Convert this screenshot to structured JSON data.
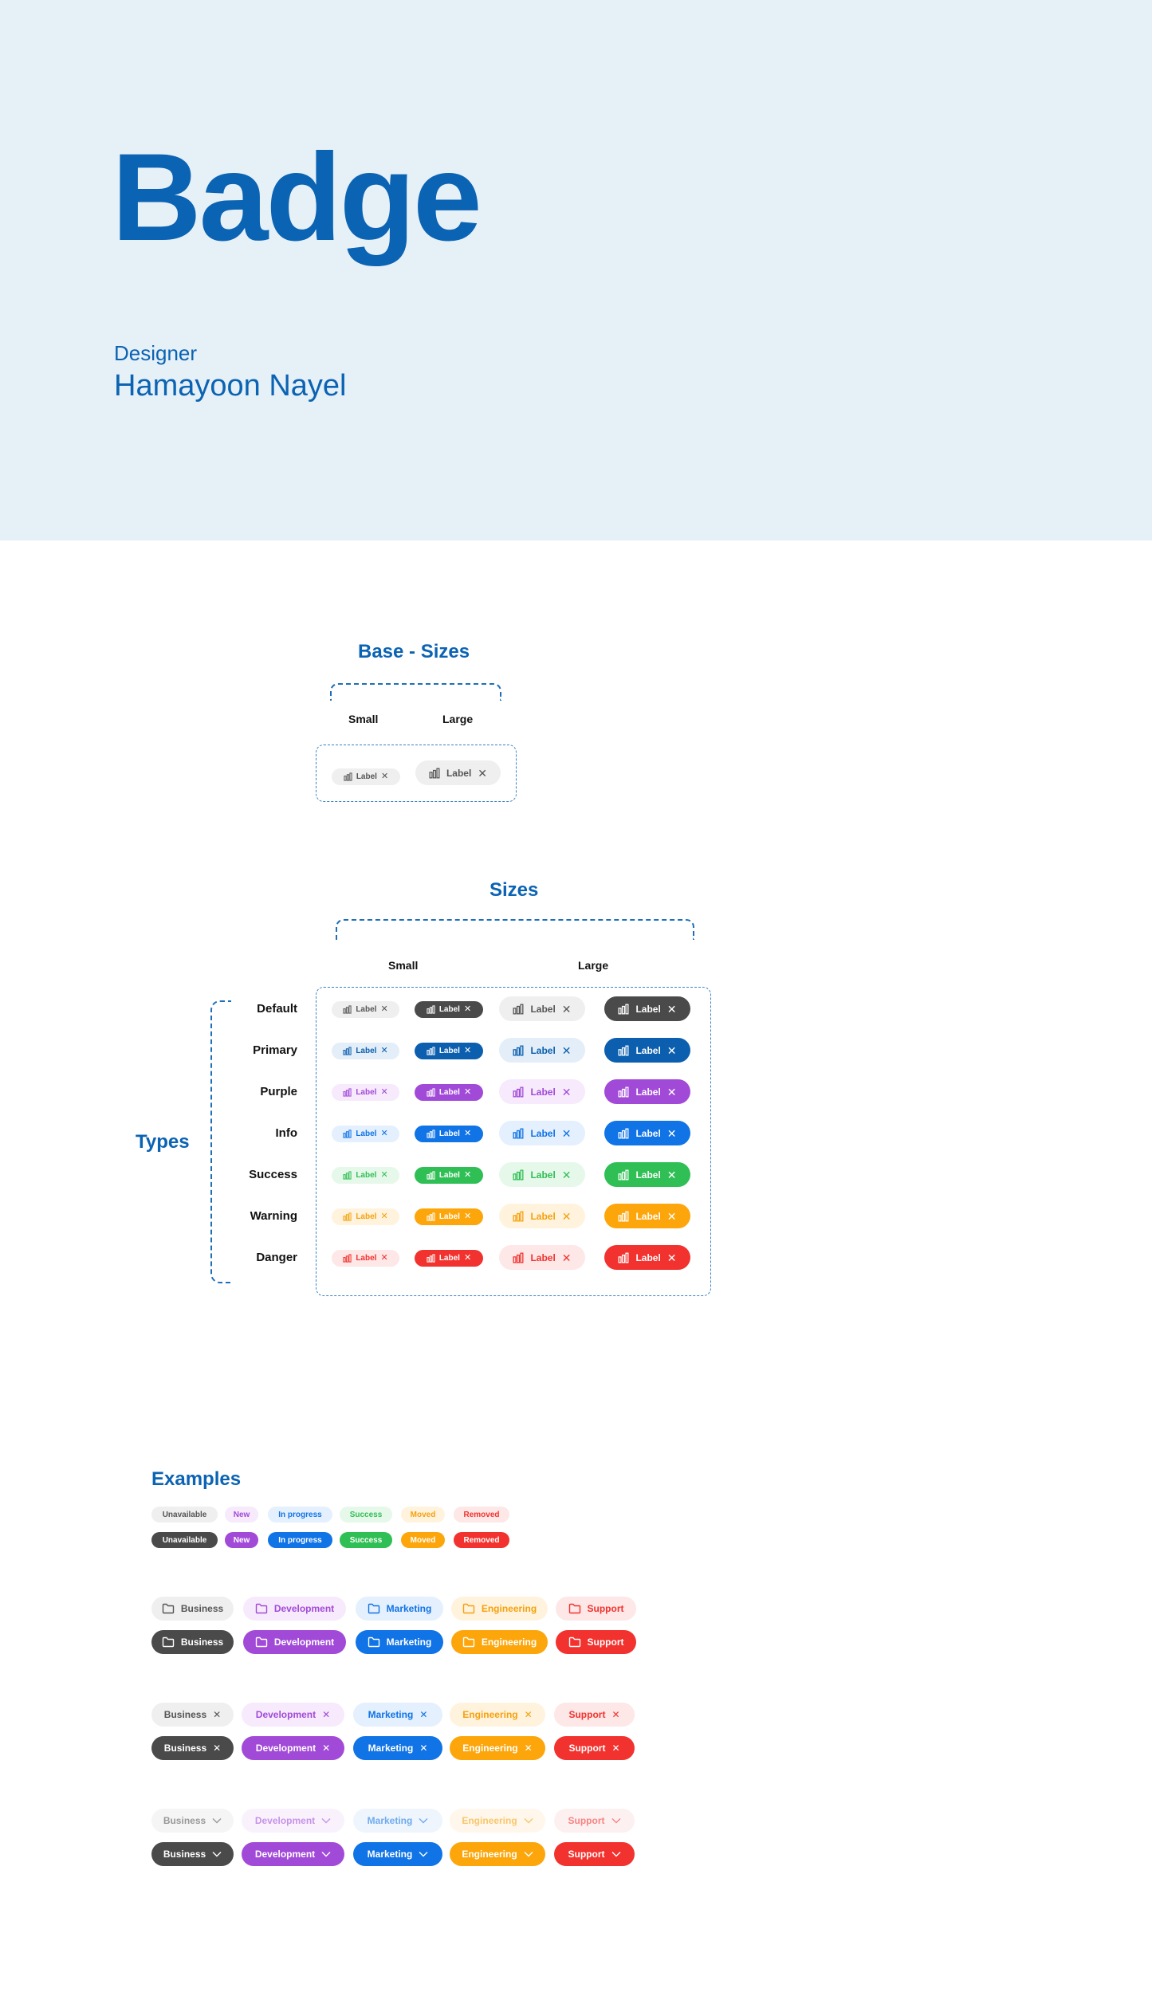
{
  "hero": {
    "title": "Badge",
    "role": "Designer",
    "name": "Hamayoon Nayel"
  },
  "base": {
    "title": "Base - Sizes",
    "small": "Small",
    "large": "Large",
    "label": "Label"
  },
  "sizes": {
    "title": "Sizes",
    "small": "Small",
    "large": "Large",
    "types_title": "Types"
  },
  "types": [
    {
      "name": "Default",
      "solid": "#4a4a4a",
      "soft": "#efefef",
      "soft_text": "#555555"
    },
    {
      "name": "Primary",
      "solid": "#0b5fae",
      "soft": "#e3eef9",
      "soft_text": "#0b5fae"
    },
    {
      "name": "Purple",
      "solid": "#a24ad8",
      "soft": "#f6eafc",
      "soft_text": "#a24ad8"
    },
    {
      "name": "Info",
      "solid": "#1073e6",
      "soft": "#e4f0fd",
      "soft_text": "#1073e6"
    },
    {
      "name": "Success",
      "solid": "#2fbf55",
      "soft": "#e6f8ea",
      "soft_text": "#2fbf55"
    },
    {
      "name": "Warning",
      "solid": "#fca60b",
      "soft": "#fff3de",
      "soft_text": "#f5a10d"
    },
    {
      "name": "Danger",
      "solid": "#f2322e",
      "soft": "#fde7e7",
      "soft_text": "#f2322e"
    }
  ],
  "badge_label": "Label",
  "examples": {
    "title": "Examples",
    "status": [
      "Unavailable",
      "New",
      "In progress",
      "Success",
      "Moved",
      "Removed"
    ],
    "departments": [
      "Business",
      "Development",
      "Marketing",
      "Engineering",
      "Support"
    ]
  },
  "icons": {
    "badge_icon": "bar-chart-icon",
    "close": "close-icon",
    "folder": "folder-icon",
    "chevron": "chevron-down-icon"
  }
}
